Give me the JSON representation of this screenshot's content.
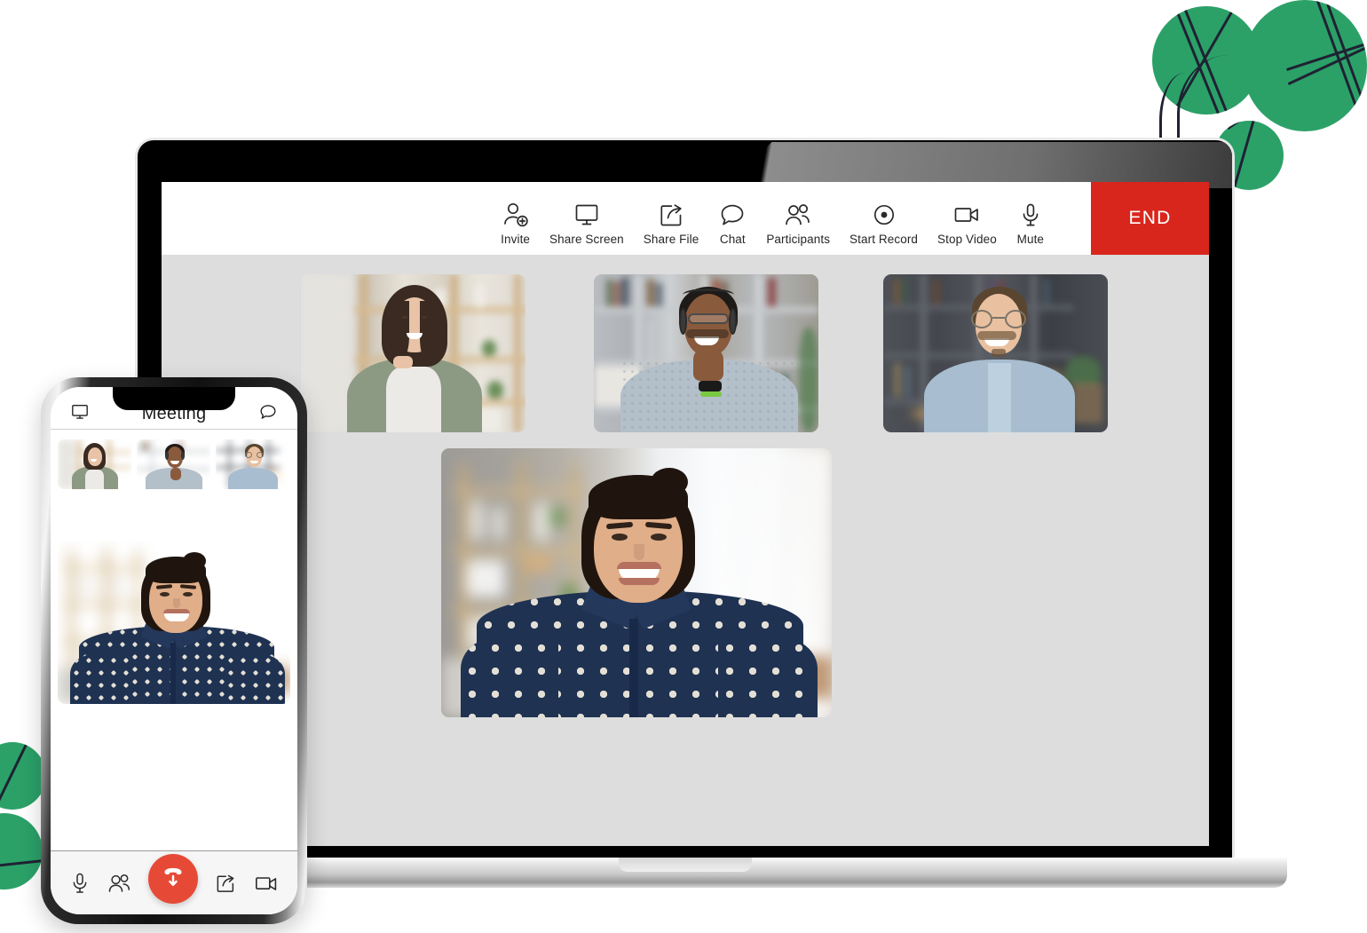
{
  "app": {
    "accent_red": "#D9261C",
    "end_call_red": "#E64A37",
    "leaf_green": "#2BA168",
    "vein_color": "#1F2233",
    "screen_bg": "#DDDDDD"
  },
  "laptop": {
    "toolbar": {
      "items": [
        {
          "label": "Invite",
          "icon": "invite-person-add-icon"
        },
        {
          "label": "Share Screen",
          "icon": "monitor-icon"
        },
        {
          "label": "Share File",
          "icon": "share-file-arrow-icon"
        },
        {
          "label": "Chat",
          "icon": "chat-bubble-icon"
        },
        {
          "label": "Participants",
          "icon": "people-icon"
        },
        {
          "label": "Start Record",
          "icon": "record-dot-icon"
        },
        {
          "label": "Stop Video",
          "icon": "video-camera-icon"
        },
        {
          "label": "Mute",
          "icon": "microphone-icon"
        }
      ],
      "end_label": "END"
    },
    "participants": [
      {
        "name": "participant-1",
        "alt": "Woman in green cardigan at desk with light wood shelves"
      },
      {
        "name": "participant-2",
        "alt": "Man wearing headset and glasses in front of bookshelf"
      },
      {
        "name": "participant-3",
        "alt": "Man in light blue shirt with glasses, dark bookshelf"
      }
    ],
    "active_speaker": {
      "name": "active-speaker",
      "alt": "Smiling woman in navy polka-dot shirt near bright window"
    }
  },
  "phone": {
    "header": {
      "title": "Meeting",
      "left_icon": "monitor-icon",
      "right_icon": "chat-bubble-icon"
    },
    "thumbnails": [
      {
        "name": "phone-participant-1"
      },
      {
        "name": "phone-participant-2"
      },
      {
        "name": "phone-participant-3"
      }
    ],
    "main_video": {
      "name": "phone-active-speaker"
    },
    "bottom_bar": [
      {
        "name": "mute-button",
        "icon": "microphone-icon"
      },
      {
        "name": "participants-button",
        "icon": "people-icon"
      },
      {
        "name": "end-call-button",
        "icon": "phone-down-arrow-icon"
      },
      {
        "name": "share-button",
        "icon": "share-file-arrow-icon"
      },
      {
        "name": "video-button",
        "icon": "video-camera-icon"
      }
    ]
  }
}
